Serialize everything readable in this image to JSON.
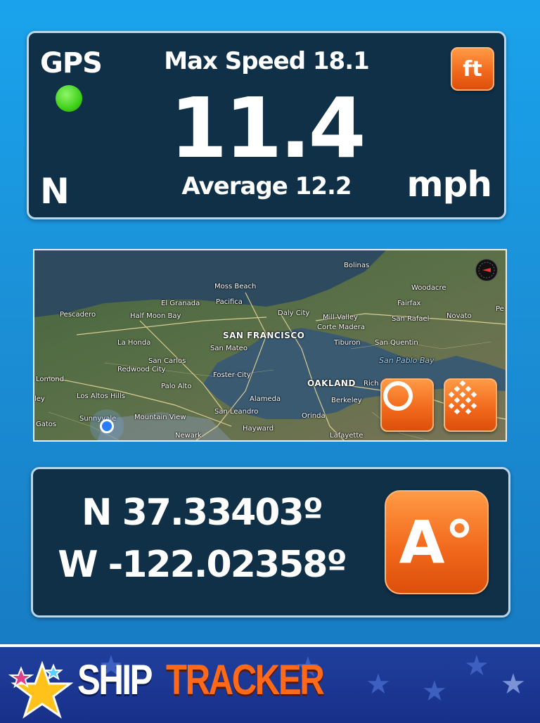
{
  "speed_panel": {
    "gps_label": "GPS",
    "gps_status_color": "#3fd11a",
    "heading": "N",
    "max_speed": "Max Speed 18.1",
    "speed": "11.4",
    "average": "Average 12.2",
    "unit": "mph",
    "unit_toggle_label": "ft"
  },
  "map": {
    "labels": [
      "Bolinas",
      "Moss Beach",
      "Woodacre",
      "El Granada",
      "Pacifica",
      "Fairfax",
      "Pescadero",
      "Half Moon Bay",
      "Daly City",
      "Mill Valley",
      "San Rafael",
      "Novato",
      "Corte Madera",
      "SAN FRANCISCO",
      "Tiburon",
      "San Quentin",
      "La Honda",
      "San Mateo",
      "San Pablo Bay",
      "San Carlos",
      "Redwood City",
      "Foster City",
      "Lomond",
      "Palo Alto",
      "OAKLAND",
      "Rich",
      "Los Altos Hills",
      "Alameda",
      "Berkeley",
      "San Leandro",
      "Orinda",
      "Mountain View",
      "Hayward",
      "Sunnyvale",
      "Gatos",
      "Newark",
      "Lafayette",
      "Pe",
      "ley"
    ],
    "record_icon": "record-icon",
    "grid_icon": "grid-icon",
    "compass_icon": "compass-icon"
  },
  "coords": {
    "latitude": "N 37.33403º",
    "longitude": "W -122.02358º",
    "format_button_label": "A°"
  },
  "banner": {
    "logo_ship": "SHIP",
    "logo_tracker": "TRACKER"
  },
  "colors": {
    "accent_orange": "#f26a1d",
    "panel_bg": "#0f3047",
    "banner_bg": "#1f3f9c"
  }
}
